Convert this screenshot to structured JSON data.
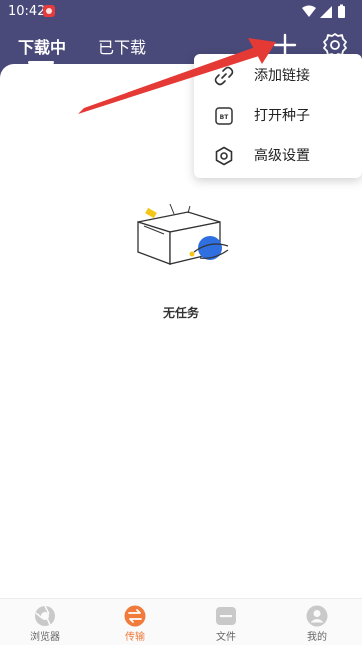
{
  "status_bar": {
    "time": "10:42"
  },
  "tabs": [
    {
      "label": "下载中",
      "active": true
    },
    {
      "label": "已下载",
      "active": false
    }
  ],
  "header_icons": [
    "plus-icon",
    "gear-icon"
  ],
  "menu": {
    "items": [
      {
        "label": "添加链接",
        "icon": "link-icon"
      },
      {
        "label": "打开种子",
        "icon": "bt-icon",
        "icon_text": "BT"
      },
      {
        "label": "高级设置",
        "icon": "hexagon-settings-icon"
      }
    ]
  },
  "empty_state": {
    "text": "无任务"
  },
  "bottom_nav": [
    {
      "label": "浏览器",
      "icon": "browser-icon",
      "active": false
    },
    {
      "label": "传输",
      "icon": "transfer-icon",
      "active": true
    },
    {
      "label": "文件",
      "icon": "folder-icon",
      "active": false
    },
    {
      "label": "我的",
      "icon": "profile-icon",
      "active": false
    }
  ],
  "colors": {
    "header": "#4a4a7a",
    "accent": "#f07b3a",
    "arrow": "#e53935"
  }
}
